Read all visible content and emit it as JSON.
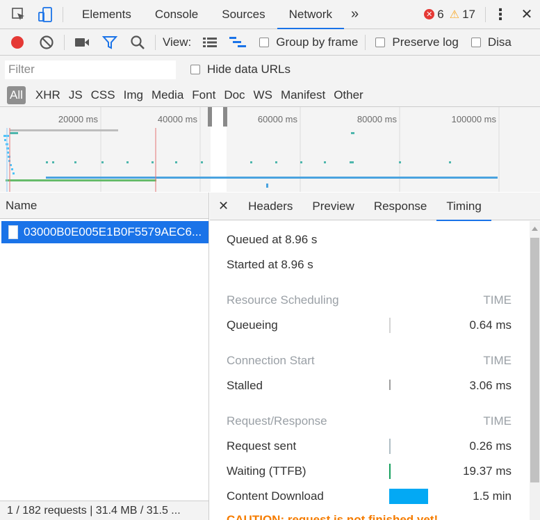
{
  "topbar": {
    "tabs": [
      "Elements",
      "Console",
      "Sources",
      "Network"
    ],
    "active_tab": "Network",
    "more_glyph": "»",
    "errors": "6",
    "warnings": "17",
    "menu_glyph": "⋮",
    "close_glyph": "✕",
    "warn_glyph": "⚠",
    "err_glyph": "✕"
  },
  "toolbar": {
    "view_label": "View:",
    "group_by_frame": "Group by frame",
    "preserve_log": "Preserve log",
    "disable_cache": "Disa"
  },
  "filter": {
    "placeholder": "Filter",
    "hide_data_urls": "Hide data URLs"
  },
  "types": [
    "All",
    "XHR",
    "JS",
    "CSS",
    "Img",
    "Media",
    "Font",
    "Doc",
    "WS",
    "Manifest",
    "Other"
  ],
  "overview": {
    "ticks": [
      "20000 ms",
      "40000 ms",
      "60000 ms",
      "80000 ms",
      "100000 ms"
    ]
  },
  "requests": {
    "header": "Name",
    "selected": "03000B0E005E1B0F5579AEC6...",
    "status": "1 / 182 requests | 31.4 MB / 31.5 ..."
  },
  "detail": {
    "close_glyph": "✕",
    "tabs": [
      "Headers",
      "Preview",
      "Response",
      "Timing"
    ],
    "active_tab": "Timing"
  },
  "timing": {
    "queued": "Queued at 8.96 s",
    "started": "Started at 8.96 s",
    "time_label": "TIME",
    "sections": [
      {
        "title": "Resource Scheduling",
        "rows": [
          {
            "label": "Queueing",
            "value": "0.64 ms"
          }
        ]
      },
      {
        "title": "Connection Start",
        "rows": [
          {
            "label": "Stalled",
            "value": "3.06 ms"
          }
        ]
      },
      {
        "title": "Request/Response",
        "rows": [
          {
            "label": "Request sent",
            "value": "0.26 ms"
          },
          {
            "label": "Waiting (TTFB)",
            "value": "19.37 ms"
          },
          {
            "label": "Content Download",
            "value": "1.5 min"
          }
        ]
      }
    ],
    "caution": "CAUTION: request is not finished yet!"
  },
  "colors": {
    "accent": "#1a73e8",
    "record": "#e53935",
    "ttfb": "#16a05d",
    "download": "#03a9f4",
    "caution": "#f57c00"
  }
}
